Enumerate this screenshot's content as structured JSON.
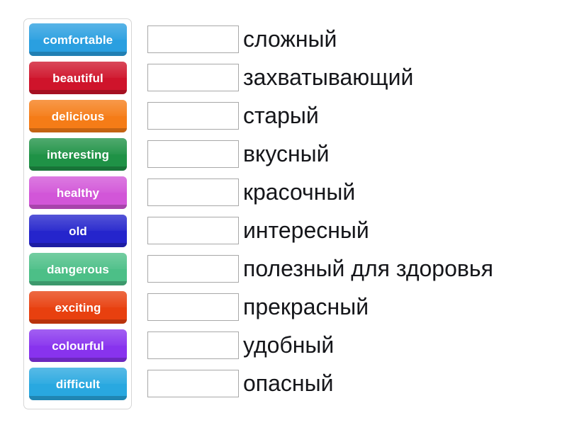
{
  "exercise": {
    "type": "match-translation",
    "background_color": "#ffffff",
    "panel_border_color": "#d6d6d6",
    "dropbox_border_color": "#a8a8a8",
    "dropbox_fill_color": "#ffffff",
    "term_text_color": "#15161a",
    "tile_text_color": "#ffffff"
  },
  "tiles": [
    {
      "label": "comfortable",
      "color": "#2a9fe0"
    },
    {
      "label": "beautiful",
      "color": "#cf142b"
    },
    {
      "label": "delicious",
      "color": "#f57c17"
    },
    {
      "label": "interesting",
      "color": "#1f9246"
    },
    {
      "label": "healthy",
      "color": "#d256d8"
    },
    {
      "label": "old",
      "color": "#2525cc"
    },
    {
      "label": "dangerous",
      "color": "#4cbf87"
    },
    {
      "label": "exciting",
      "color": "#e8400f"
    },
    {
      "label": "colourful",
      "color": "#8833ee"
    },
    {
      "label": "difficult",
      "color": "#29a8e0"
    }
  ],
  "rows": [
    {
      "answer": "",
      "term": "сложный"
    },
    {
      "answer": "",
      "term": "захватывающий"
    },
    {
      "answer": "",
      "term": "старый"
    },
    {
      "answer": "",
      "term": "вкусный"
    },
    {
      "answer": "",
      "term": "красочный"
    },
    {
      "answer": "",
      "term": "интересный"
    },
    {
      "answer": "",
      "term": "полезный для здоровья"
    },
    {
      "answer": "",
      "term": "прекрасный"
    },
    {
      "answer": "",
      "term": "удобный"
    },
    {
      "answer": "",
      "term": "опасный"
    }
  ]
}
